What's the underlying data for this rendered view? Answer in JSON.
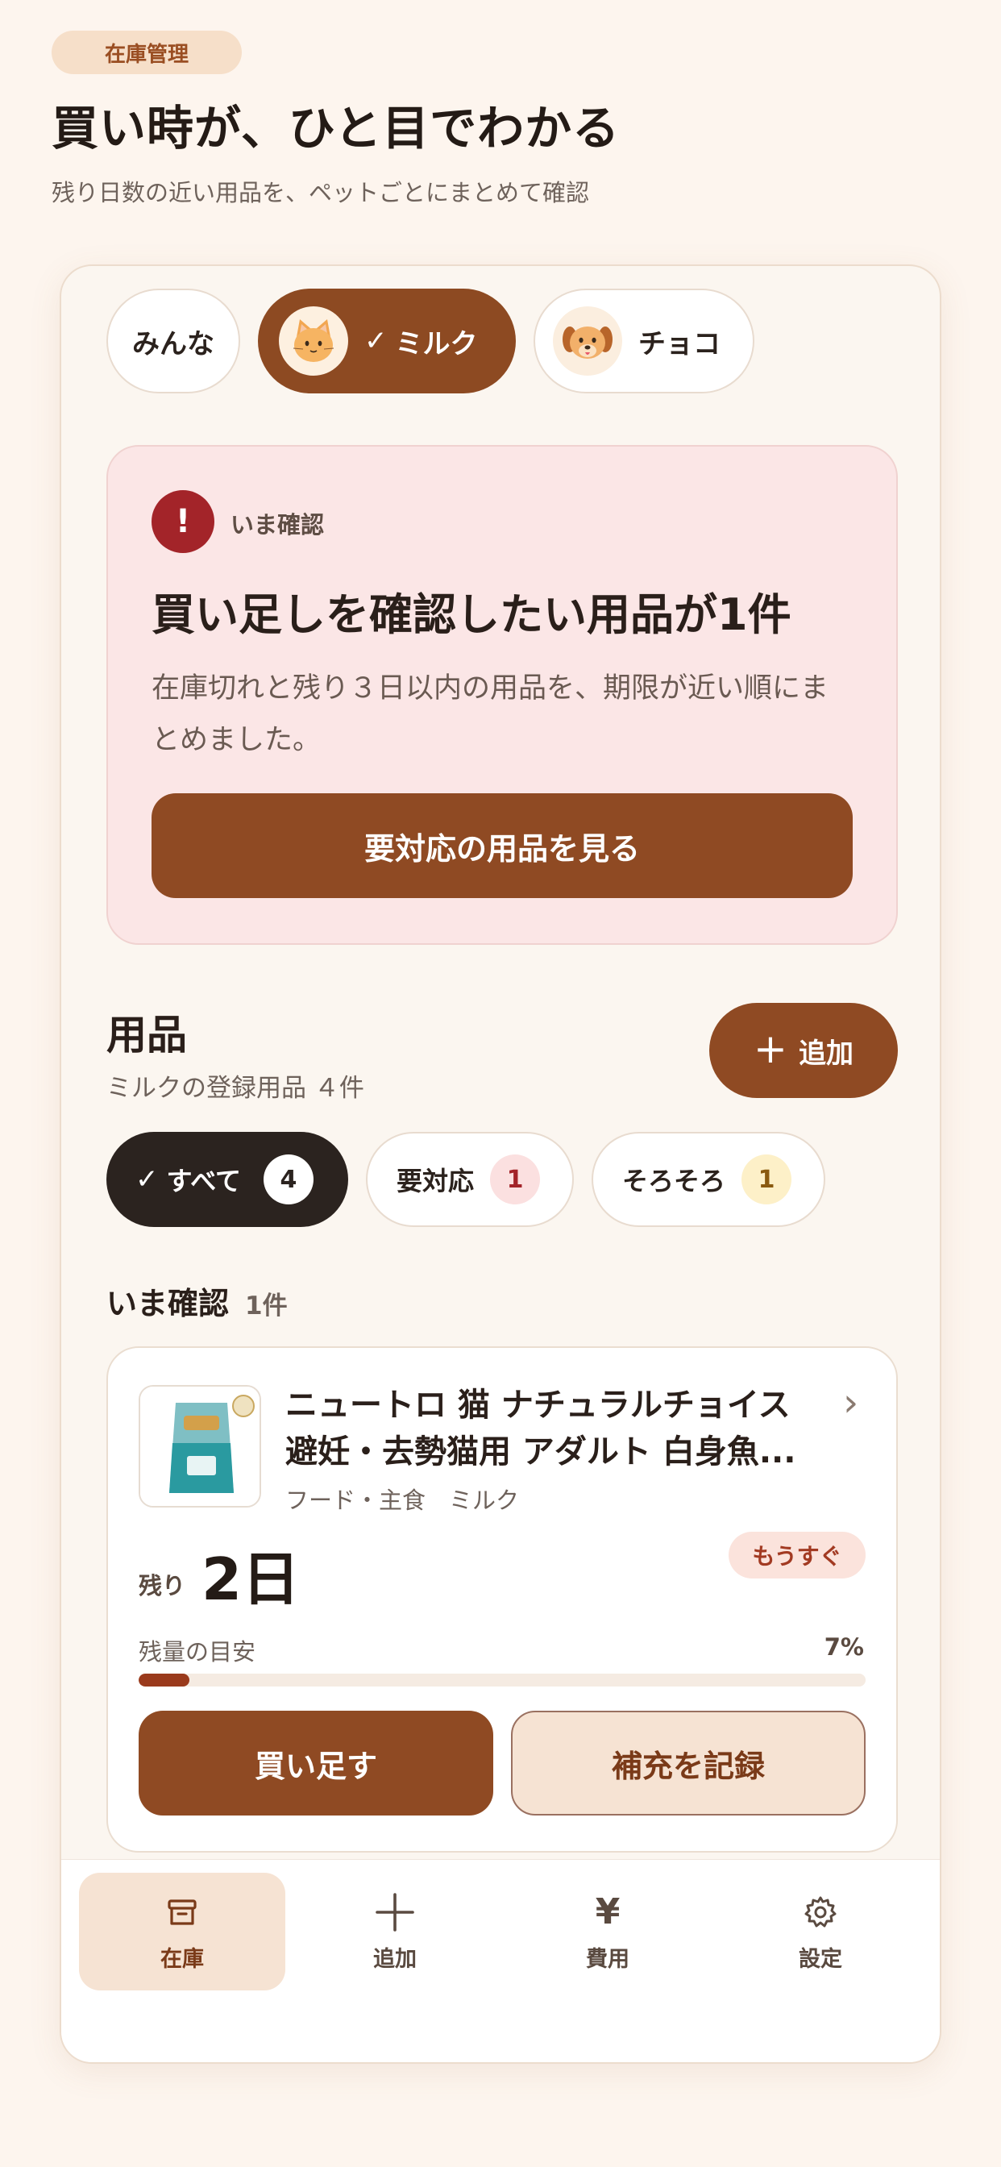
{
  "header": {
    "badge": "在庫管理",
    "title": "買い時が、ひと目でわかる",
    "subtitle": "残り日数の近い用品を、ペットごとにまとめて確認"
  },
  "pets": [
    {
      "label": "みんな"
    },
    {
      "label": "ミルク",
      "selected": true,
      "icon": "cat-icon"
    },
    {
      "label": "チョコ",
      "icon": "dog-icon"
    }
  ],
  "alert": {
    "tag": "いま確認",
    "title": "買い足しを確認したい用品が1件",
    "description": "在庫切れと残り３日以内の用品を、期限が近い順にまとめました。",
    "button": "要対応の用品を見る",
    "color": "#a32429"
  },
  "section": {
    "title": "用品",
    "subtitle": "ミルクの登録用品 ４件",
    "add_button": "追加"
  },
  "filters": [
    {
      "label": "すべて",
      "count": "4",
      "selected": true
    },
    {
      "label": "要対応",
      "count": "1"
    },
    {
      "label": "そろそろ",
      "count": "1"
    }
  ],
  "list": {
    "heading": "いま確認",
    "count": "1件"
  },
  "item": {
    "name": "ニュートロ 猫 ナチュラルチョイス 避妊・去勢猫用 アダルト 白身魚...",
    "category": "フード・主食",
    "pet": "ミルク",
    "remain_label": "残り",
    "remain_value": "2日",
    "status_badge": "もうすぐ",
    "gauge_label": "残量の目安",
    "gauge_percent_text": "7%",
    "gauge_fraction": 0.07,
    "buy_button": "買い足す",
    "record_button": "補充を記録"
  },
  "nav": [
    {
      "label": "在庫",
      "icon": "box-icon",
      "active": true
    },
    {
      "label": "追加",
      "icon": "plus-icon"
    },
    {
      "label": "費用",
      "icon": "yen-icon"
    },
    {
      "label": "設定",
      "icon": "gear-icon"
    }
  ],
  "colors": {
    "accent": "#8f4a23",
    "background": "#fdf5ee",
    "alert_bg": "#fbe6e6"
  }
}
